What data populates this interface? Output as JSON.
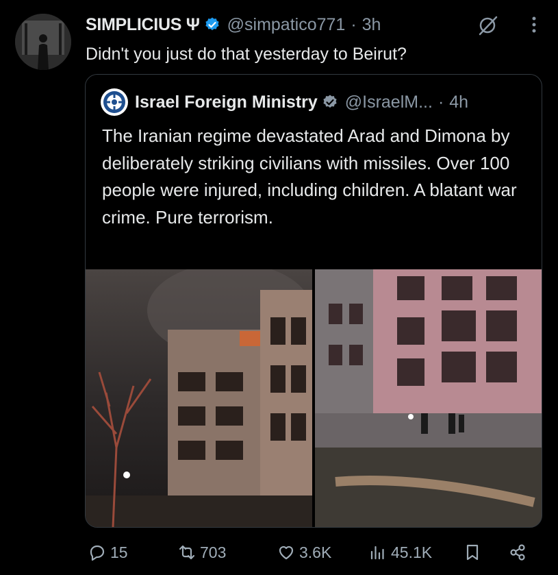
{
  "tweet": {
    "author_name": "SIMPLICIUS Ψ",
    "handle": "@simpatico771",
    "separator": "·",
    "time": "3h",
    "text": "Didn't you just do that yesterday to Beirut?"
  },
  "quoted": {
    "author_name": "Israel Foreign Ministry",
    "handle": "@IsraelM...",
    "separator": "·",
    "time": "4h",
    "text": "The Iranian regime devastated Arad and Dimona by deliberately striking civilians with missiles. Over 100 people were injured, including children. A blatant war crime. Pure terrorism."
  },
  "actions": {
    "replies": "15",
    "reposts": "703",
    "likes": "3.6K",
    "views": "45.1K"
  },
  "colors": {
    "background": "#000000",
    "text": "#e7e9ea",
    "muted": "#8b98a5",
    "verified": "#1d9bf0",
    "border": "#333a40"
  },
  "icons": [
    "verified-badge-icon",
    "grok-icon",
    "more-icon",
    "reply-icon",
    "repost-icon",
    "like-icon",
    "views-icon",
    "bookmark-icon",
    "share-icon"
  ]
}
